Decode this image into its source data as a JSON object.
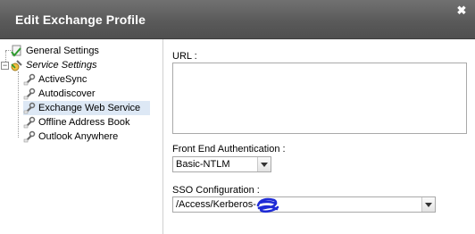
{
  "dialog": {
    "title": "Edit Exchange Profile",
    "close_glyph": "✖"
  },
  "sidebar": {
    "items": [
      {
        "label": "General Settings",
        "icon": "check-settings-icon"
      },
      {
        "label": "Service Settings",
        "icon": "settings-group-icon",
        "italic": true,
        "expanded": true
      },
      {
        "label": "ActiveSync",
        "icon": "wrench-icon"
      },
      {
        "label": "Autodiscover",
        "icon": "wrench-icon"
      },
      {
        "label": "Exchange Web Service",
        "icon": "wrench-icon",
        "selected": true
      },
      {
        "label": "Offline Address Book",
        "icon": "wrench-icon"
      },
      {
        "label": "Outlook Anywhere",
        "icon": "wrench-icon"
      }
    ],
    "selected_color": "#dde8f5"
  },
  "form": {
    "url_label": "URL :",
    "url_value": "",
    "frontend_auth_label": "Front End Authentication :",
    "frontend_auth_value": "Basic-NTLM",
    "sso_label": "SSO Configuration :",
    "sso_value": "/Access/Kerberos-"
  },
  "colors": {
    "titlebar": "#5a5a5a",
    "scribble": "#1f2bd6"
  }
}
